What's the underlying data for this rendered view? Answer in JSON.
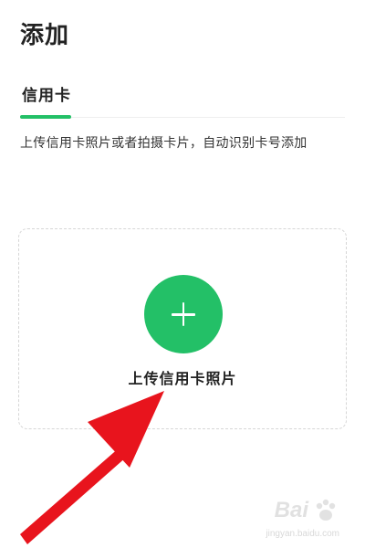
{
  "header": {
    "title": "添加"
  },
  "tabs": [
    {
      "label": "信用卡",
      "active": true
    }
  ],
  "description": "上传信用卡照片或者拍摄卡片，自动识别卡号添加",
  "upload_card": {
    "icon": "plus-icon",
    "label": "上传信用卡照片"
  },
  "watermark": {
    "brand": "Bai",
    "sub": "jingyan.baidu.com"
  },
  "colors": {
    "accent": "#23c067",
    "arrow": "#e8141d"
  }
}
